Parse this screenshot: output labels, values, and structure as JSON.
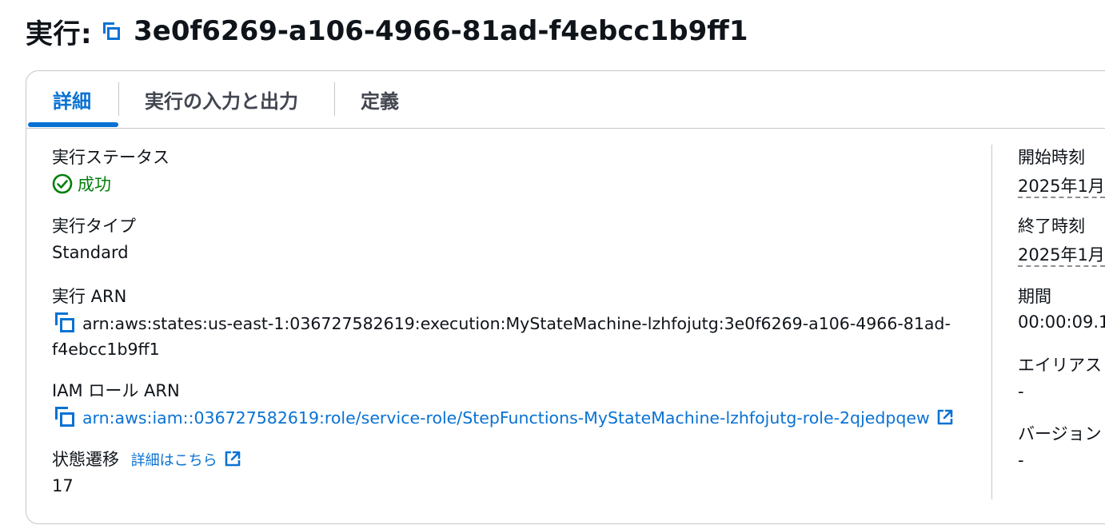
{
  "header": {
    "title_prefix": "実行:",
    "execution_id": "3e0f6269-a106-4966-81ad-f4ebcc1b9ff1"
  },
  "tabs": [
    {
      "label": "詳細",
      "active": true
    },
    {
      "label": "実行の入力と出力",
      "active": false
    },
    {
      "label": "定義",
      "active": false
    }
  ],
  "details": {
    "status_label": "実行ステータス",
    "status_value": "成功",
    "type_label": "実行タイプ",
    "type_value": "Standard",
    "arn_label": "実行 ARN",
    "arn_line1": "arn:aws:states:us-east-1:036727582619:execution:MyStateMachine-lzhfojutg:3e0f6269-a106-4966-81ad-",
    "arn_line2": "f4ebcc1b9ff1",
    "iam_label": "IAM ロール ARN",
    "iam_value": "arn:aws:iam::036727582619:role/service-role/StepFunctions-MyStateMachine-lzhfojutg-role-2qjedpqew",
    "transitions_label": "状態遷移",
    "transitions_link": "詳細はこちら",
    "transitions_value": "17"
  },
  "right_column": {
    "start_label": "開始時刻",
    "start_value": "2025年1月",
    "end_label": "終了時刻",
    "end_value": "2025年1月",
    "duration_label": "期間",
    "duration_value": "00:00:09.1",
    "alias_label": "エイリアス",
    "alias_value": "-",
    "version_label": "バージョン",
    "version_value": "-"
  },
  "colors": {
    "accent": "#0972d3",
    "success": "#037f0c",
    "text": "#0f141a",
    "border": "#c6c6cd"
  }
}
